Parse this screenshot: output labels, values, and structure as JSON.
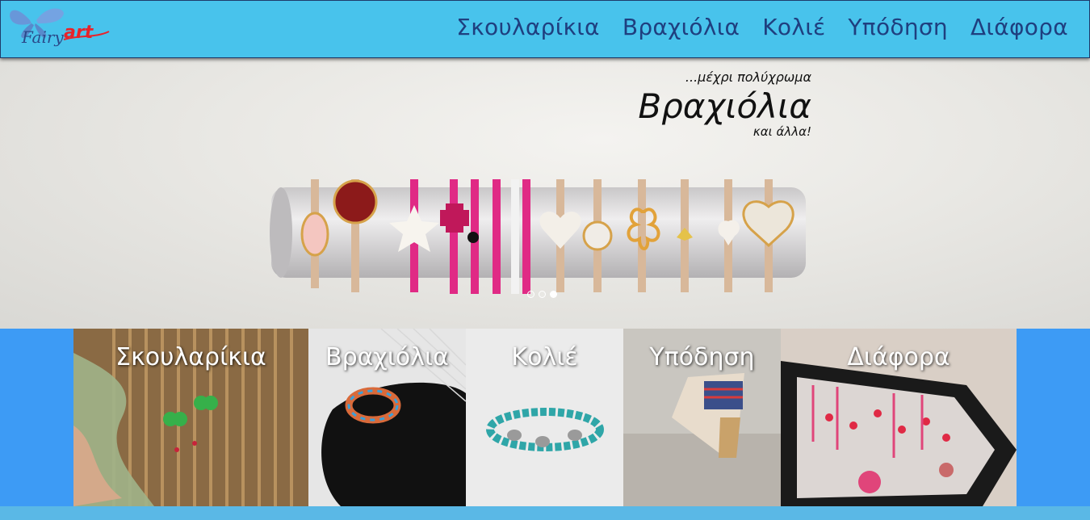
{
  "header": {
    "logo_text": "fairyart",
    "nav": [
      {
        "label": "Σκουλαρίκια"
      },
      {
        "label": "Βραχιόλια"
      },
      {
        "label": "Κολιέ"
      },
      {
        "label": "Υπόδηση"
      },
      {
        "label": "Διάφορα"
      }
    ]
  },
  "hero": {
    "pre": "...μέχρι πολύχρωμα",
    "title": "Βραχιόλια",
    "post": "και άλλα!",
    "slides_total": 3,
    "active_slide": 3
  },
  "categories": [
    {
      "label": "Σκουλαρίκια"
    },
    {
      "label": "Βραχιόλια"
    },
    {
      "label": "Κολιέ"
    },
    {
      "label": "Υπόδηση"
    },
    {
      "label": "Διάφορα"
    }
  ],
  "colors": {
    "header_bg": "#48c3ec",
    "nav_text": "#1f3f7f",
    "page_bg": "#3d9bf5",
    "footer_strip": "#5ab8e6"
  }
}
